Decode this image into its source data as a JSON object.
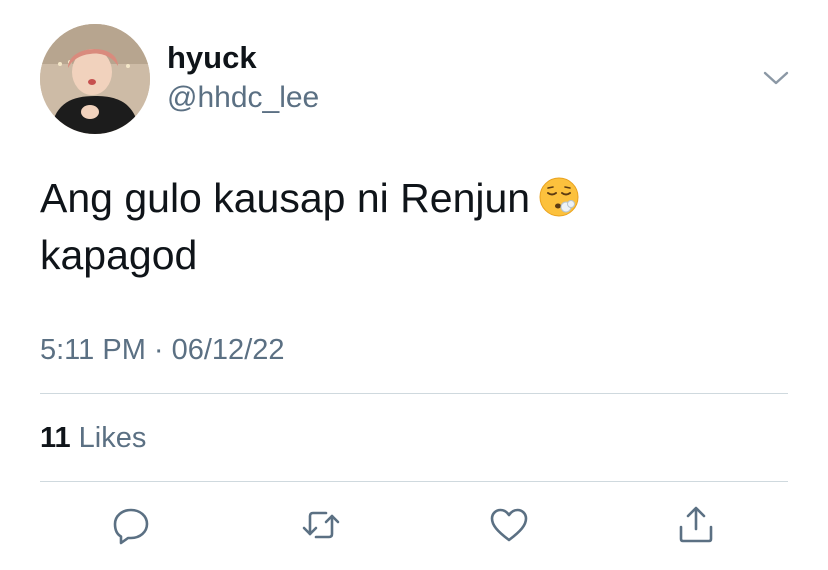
{
  "author": {
    "display_name": "hyuck",
    "handle": "@hhdc_lee"
  },
  "tweet": {
    "text_line1": "Ang gulo kausap ni Renjun",
    "emoji": "face-exhaling-emoji",
    "text_line2": "kapagod",
    "timestamp": "5:11 PM · 06/12/22"
  },
  "stats": {
    "likes_count": "11",
    "likes_label": "Likes"
  },
  "actions": {
    "reply": "reply-icon",
    "retweet": "retweet-icon",
    "like": "heart-icon",
    "share": "share-icon"
  },
  "colors": {
    "text": "#0f1419",
    "secondary": "#5b7083",
    "divider": "#cfd9de"
  }
}
